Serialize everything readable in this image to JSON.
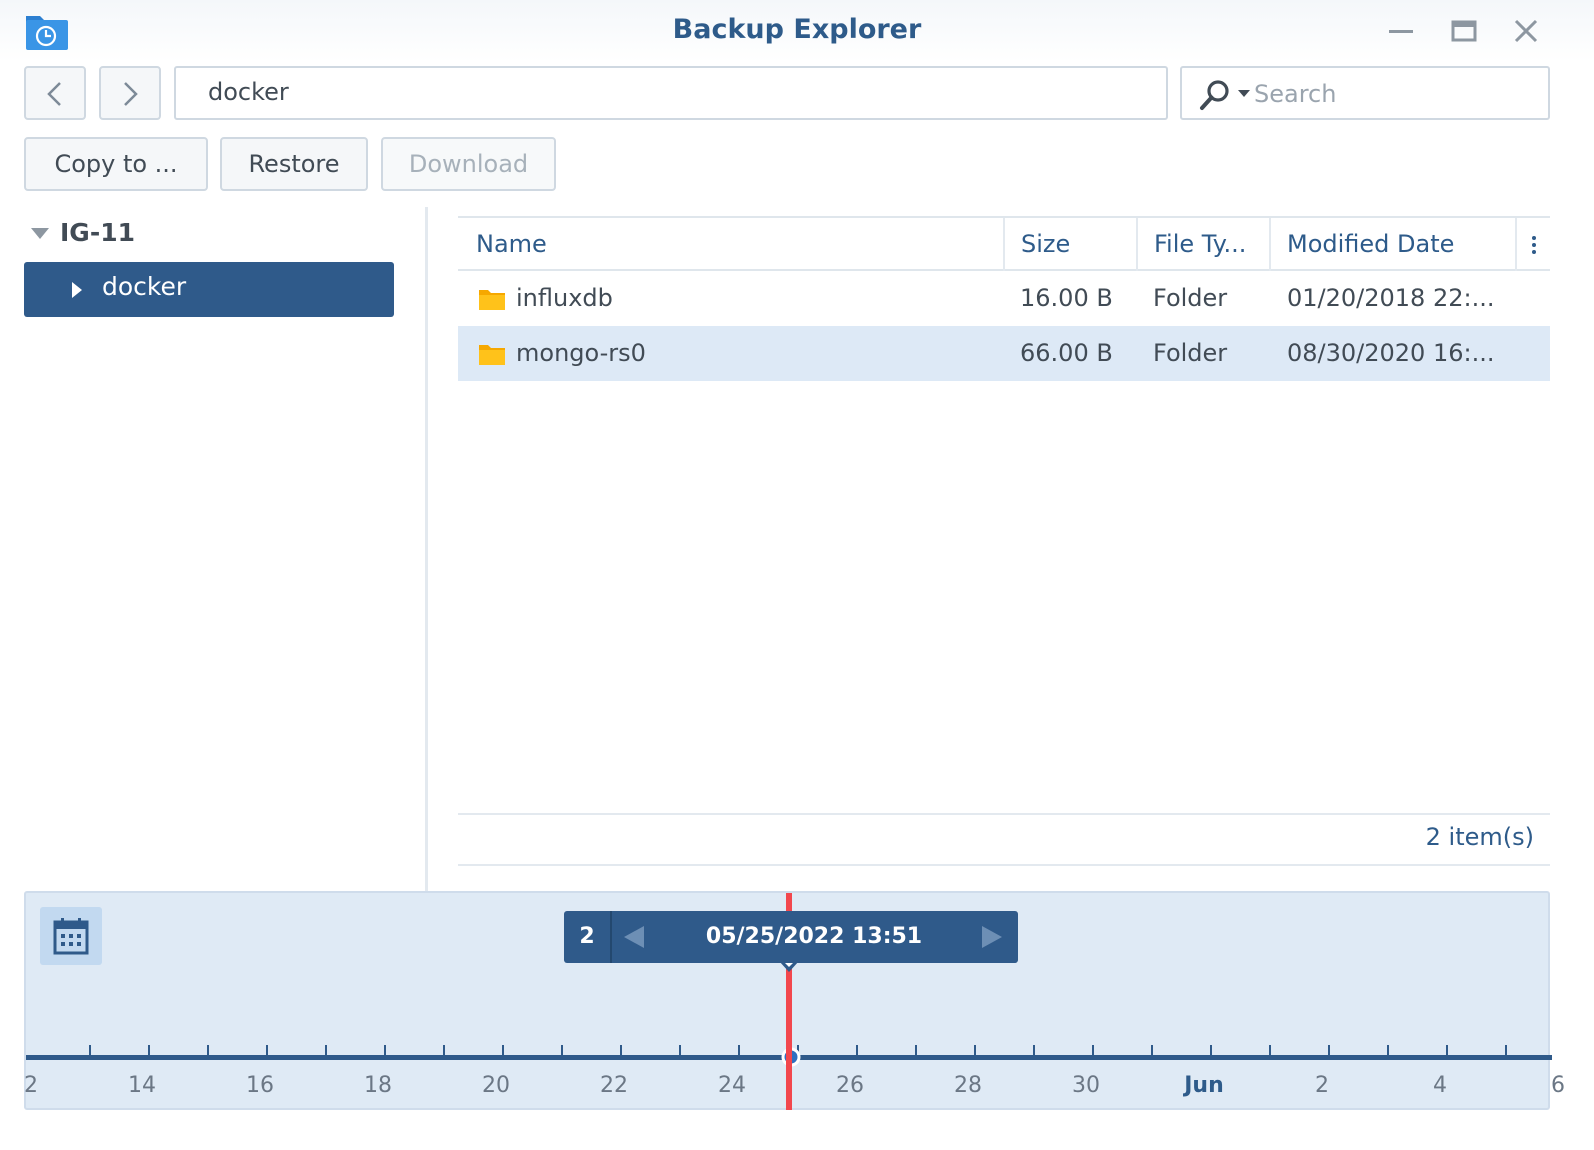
{
  "window": {
    "title": "Backup Explorer",
    "app_icon": "backup-explorer-icon",
    "controls": [
      "minimize-icon",
      "maximize-icon",
      "close-icon"
    ]
  },
  "nav": {
    "back_icon": "chevron-left-icon",
    "forward_icon": "chevron-right-icon",
    "path": "docker"
  },
  "search": {
    "placeholder": "Search",
    "value": "",
    "icon": "search-icon"
  },
  "toolbar": {
    "copy_label": "Copy to ...",
    "restore_label": "Restore",
    "download_label": "Download"
  },
  "tree": {
    "root": "IG-11",
    "items": [
      {
        "label": "docker",
        "selected": true
      }
    ]
  },
  "grid": {
    "columns": [
      "Name",
      "Size",
      "File Ty...",
      "Modified Date"
    ],
    "rows": [
      {
        "name": "influxdb",
        "size": "16.00 B",
        "type": "Folder",
        "modified": "01/20/2018 22:...",
        "selected": false
      },
      {
        "name": "mongo-rs0",
        "size": "66.00 B",
        "type": "Folder",
        "modified": "08/30/2020 16:...",
        "selected": true
      }
    ],
    "item_count": "2 item(s)"
  },
  "timeline": {
    "version_count": "2",
    "version_datetime": "05/25/2022 13:51",
    "axis_labels": [
      "2",
      "14",
      "16",
      "18",
      "20",
      "22",
      "24",
      "26",
      "28",
      "30",
      "Jun",
      "2",
      "4",
      "6"
    ],
    "month_label": "Jun",
    "colors": {
      "bar": "#2f5a8a",
      "cursor": "#f2474d",
      "background": "#dfeaf5"
    }
  }
}
